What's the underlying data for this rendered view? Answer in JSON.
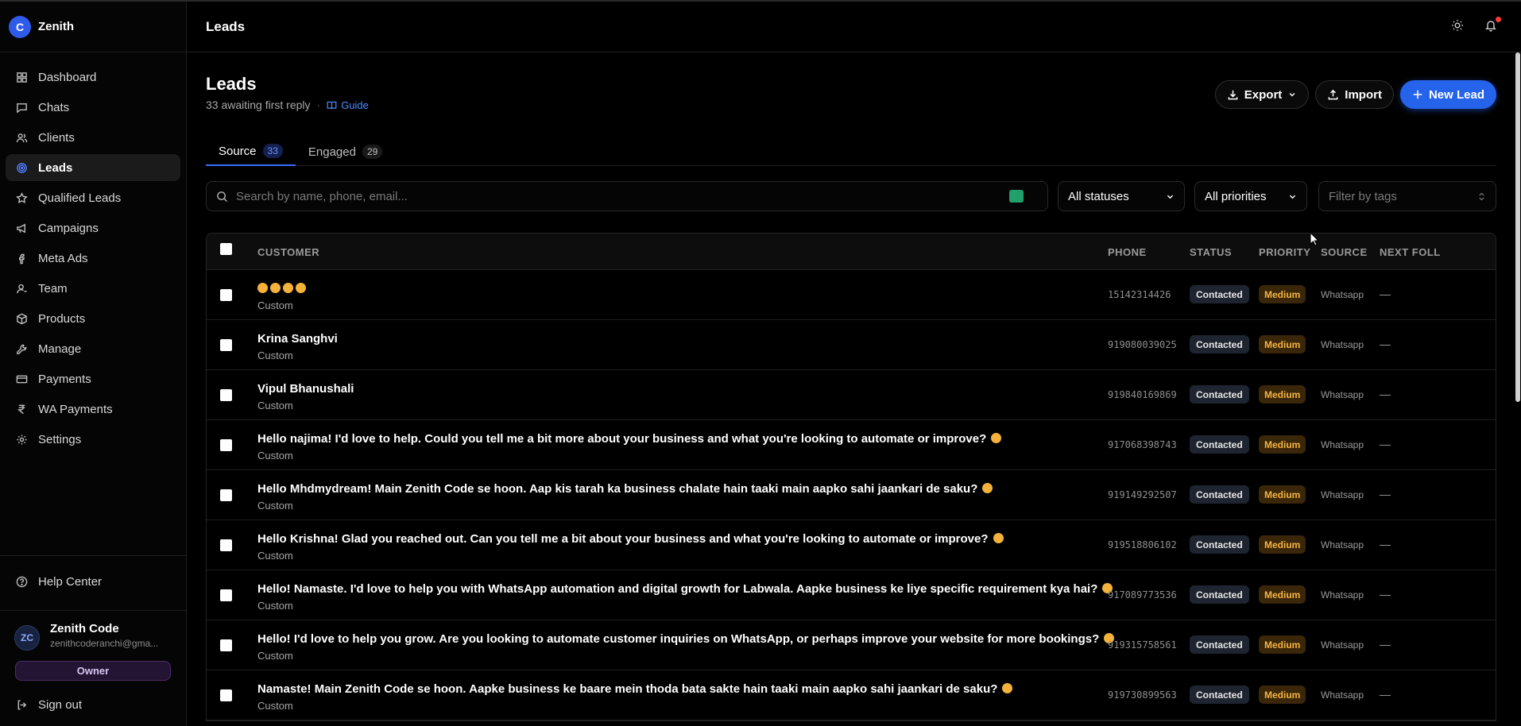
{
  "brand": {
    "logo_letter": "C",
    "name": "Zenith"
  },
  "sidebar": {
    "items": [
      {
        "label": "Dashboard",
        "icon": "dashboard-icon"
      },
      {
        "label": "Chats",
        "icon": "chat-icon"
      },
      {
        "label": "Clients",
        "icon": "users-icon"
      },
      {
        "label": "Leads",
        "icon": "target-icon",
        "active": true
      },
      {
        "label": "Qualified Leads",
        "icon": "star-icon"
      },
      {
        "label": "Campaigns",
        "icon": "megaphone-icon"
      },
      {
        "label": "Meta Ads",
        "icon": "facebook-icon"
      },
      {
        "label": "Team",
        "icon": "user-icon"
      },
      {
        "label": "Products",
        "icon": "box-icon"
      },
      {
        "label": "Manage",
        "icon": "wrench-icon"
      },
      {
        "label": "Payments",
        "icon": "credit-card-icon"
      },
      {
        "label": "WA Payments",
        "icon": "rupee-icon"
      },
      {
        "label": "Settings",
        "icon": "gear-icon"
      }
    ],
    "help_label": "Help Center",
    "user": {
      "initials": "ZC",
      "name": "Zenith Code",
      "email": "zenithcoderanchi@gma...",
      "role": "Owner"
    },
    "signout_label": "Sign out"
  },
  "topbar": {
    "title": "Leads"
  },
  "page": {
    "title": "Leads",
    "subtitle": "33 awaiting first reply",
    "guide_label": "Guide",
    "actions": {
      "export": "Export",
      "import": "Import",
      "new_lead": "New Lead"
    }
  },
  "tabs": [
    {
      "label": "Source",
      "count": "33",
      "active": true
    },
    {
      "label": "Engaged",
      "count": "29",
      "active": false
    }
  ],
  "filters": {
    "search_placeholder": "Search by name, phone, email...",
    "status": "All statuses",
    "priority": "All priorities",
    "tags_placeholder": "Filter by tags"
  },
  "table": {
    "columns": {
      "customer": "CUSTOMER",
      "phone": "PHONE",
      "status": "STATUS",
      "priority": "PRIORITY",
      "source": "SOURCE",
      "next": "NEXT FOLL"
    },
    "rows": [
      {
        "name": "",
        "emoji_only": 4,
        "sub": "Custom",
        "phone": "15142314426",
        "status": "Contacted",
        "priority": "Medium",
        "source": "Whatsapp",
        "next": "—"
      },
      {
        "name": "Krina Sanghvi",
        "sub": "Custom",
        "phone": "919080039025",
        "status": "Contacted",
        "priority": "Medium",
        "source": "Whatsapp",
        "next": "—"
      },
      {
        "name": "Vipul Bhanushali",
        "sub": "Custom",
        "phone": "919840169869",
        "status": "Contacted",
        "priority": "Medium",
        "source": "Whatsapp",
        "next": "—"
      },
      {
        "name": "Hello najima! I'd love to help. Could you tell me a bit more about your business and what you're looking to automate or improve?",
        "emoji": true,
        "sub": "Custom",
        "phone": "917068398743",
        "status": "Contacted",
        "priority": "Medium",
        "source": "Whatsapp",
        "next": "—"
      },
      {
        "name": "Hello Mhdmydream! Main Zenith Code se hoon. Aap kis tarah ka business chalate hain taaki main aapko sahi jaankari de saku?",
        "emoji": true,
        "sub": "Custom",
        "phone": "919149292507",
        "status": "Contacted",
        "priority": "Medium",
        "source": "Whatsapp",
        "next": "—"
      },
      {
        "name": "Hello Krishna! Glad you reached out. Can you tell me a bit about your business and what you're looking to automate or improve?",
        "emoji": true,
        "sub": "Custom",
        "phone": "919518806102",
        "status": "Contacted",
        "priority": "Medium",
        "source": "Whatsapp",
        "next": "—"
      },
      {
        "name": "Hello! Namaste. I'd love to help you with WhatsApp automation and digital growth for Labwala. Aapke business ke liye specific requirement kya hai?",
        "emoji": true,
        "sub": "Custom",
        "phone": "917089773536",
        "status": "Contacted",
        "priority": "Medium",
        "source": "Whatsapp",
        "next": "—"
      },
      {
        "name": "Hello! I'd love to help you grow. Are you looking to automate customer inquiries on WhatsApp, or perhaps improve your website for more bookings?",
        "emoji": true,
        "sub": "Custom",
        "phone": "919315758561",
        "status": "Contacted",
        "priority": "Medium",
        "source": "Whatsapp",
        "next": "—"
      },
      {
        "name": "Namaste! Main Zenith Code se hoon. Aapke business ke baare mein thoda bata sakte hain taaki main aapko sahi jaankari de saku?",
        "emoji": true,
        "sub": "Custom",
        "phone": "919730899563",
        "status": "Contacted",
        "priority": "Medium",
        "source": "Whatsapp",
        "next": "—"
      }
    ]
  },
  "colors": {
    "accent": "#2563eb",
    "priority_text": "#f5b544",
    "status_bg": "#1f2530"
  }
}
